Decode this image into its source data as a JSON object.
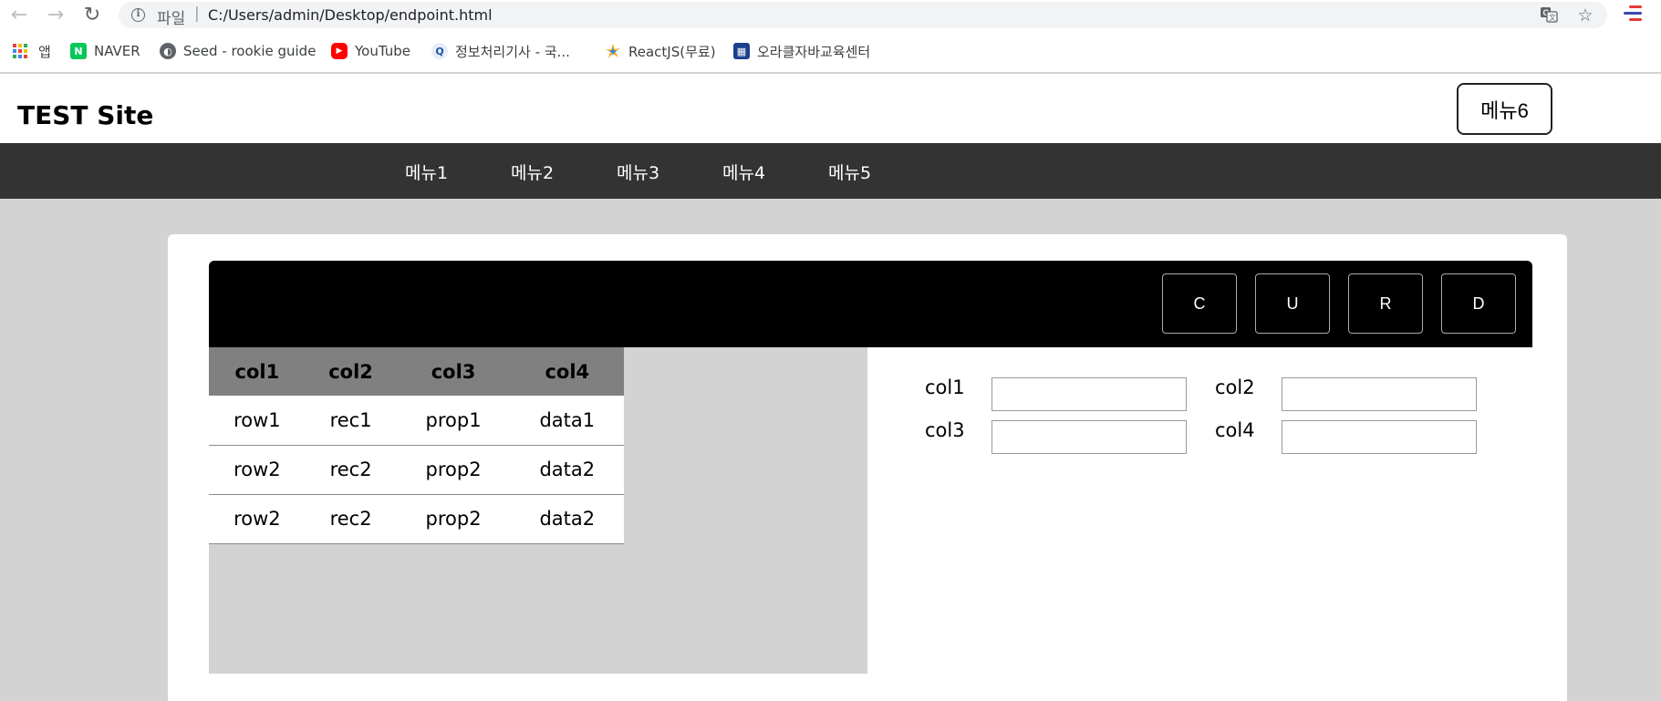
{
  "browser": {
    "url_scheme": "파일",
    "url_separator": "|",
    "url": "C:/Users/admin/Desktop/endpoint.html",
    "bookmarks": [
      {
        "label": "앱",
        "icon": "apps-grid-icon"
      },
      {
        "label": "NAVER",
        "icon": "naver-icon",
        "color": "#03c75a",
        "glyph": "N"
      },
      {
        "label": "Seed - rookie guide",
        "icon": "globe-icon"
      },
      {
        "label": "YouTube",
        "icon": "youtube-icon",
        "color": "#ff0000",
        "glyph": "▶"
      },
      {
        "label": "정보처리기사 - 국...",
        "icon": "q-site-icon",
        "glyph": "Q"
      },
      {
        "label": "ReactJS(무료)",
        "icon": "star-burst-icon"
      },
      {
        "label": "오라클자바교육센터",
        "icon": "oracle-java-icon",
        "color": "#1a3f8f"
      }
    ]
  },
  "site": {
    "title": "TEST Site",
    "top_right_button": "메뉴6",
    "nav_items": [
      "메뉴1",
      "메뉴2",
      "메뉴3",
      "메뉴4",
      "메뉴5"
    ]
  },
  "crud_buttons": [
    "C",
    "U",
    "R",
    "D"
  ],
  "table": {
    "headers": [
      "col1",
      "col2",
      "col3",
      "col4"
    ],
    "rows": [
      [
        "row1",
        "rec1",
        "prop1",
        "data1"
      ],
      [
        "row2",
        "rec2",
        "prop2",
        "data2"
      ],
      [
        "row2",
        "rec2",
        "prop2",
        "data2"
      ]
    ]
  },
  "form": {
    "fields": [
      {
        "label": "col1",
        "value": ""
      },
      {
        "label": "col2",
        "value": ""
      },
      {
        "label": "col3",
        "value": ""
      },
      {
        "label": "col4",
        "value": ""
      }
    ]
  },
  "colors": {
    "nav_bg": "#333333",
    "page_bg": "#d3d3d3",
    "table_header_bg": "#808080",
    "crud_bar_bg": "#000000"
  }
}
